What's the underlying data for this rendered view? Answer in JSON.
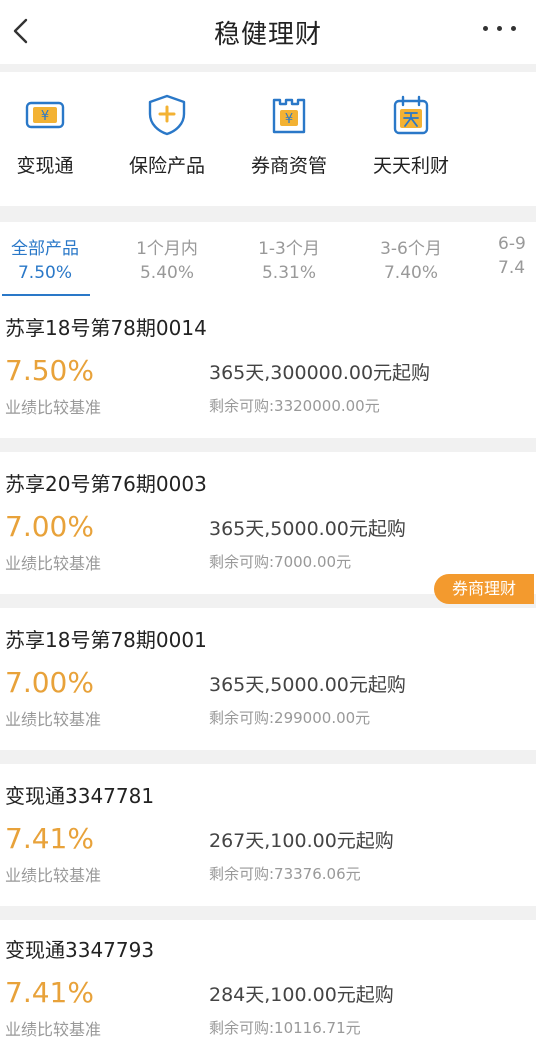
{
  "header": {
    "title": "稳健理财",
    "back_icon": "chevron-left-icon",
    "more_icon": "more-horizontal-icon"
  },
  "accent_color": "#2a78c8",
  "rate_color": "#e8a23a",
  "badge_color": "#f39a2e",
  "quick_links": [
    {
      "label": "变现通",
      "icon": "yen-ticket-icon"
    },
    {
      "label": "保险产品",
      "icon": "shield-plus-icon"
    },
    {
      "label": "券商资管",
      "icon": "yen-tower-icon"
    },
    {
      "label": "天天利财",
      "icon": "calendar-tian-icon"
    }
  ],
  "tabs": [
    {
      "label": "全部产品",
      "rate": "7.50%",
      "active": true
    },
    {
      "label": "1个月内",
      "rate": "5.40%"
    },
    {
      "label": "1-3个月",
      "rate": "5.31%"
    },
    {
      "label": "3-6个月",
      "rate": "7.40%"
    },
    {
      "label": "6-9",
      "rate": "7.4"
    }
  ],
  "products": [
    {
      "name": "苏享18号第78期0014",
      "rate": "7.50%",
      "rate_label": "业绩比较基准",
      "terms": "365天,300000.00元起购",
      "remaining": "剩余可购:3320000.00元"
    },
    {
      "name": "苏享20号第76期0003",
      "rate": "7.00%",
      "rate_label": "业绩比较基准",
      "terms": "365天,5000.00元起购",
      "remaining": "剩余可购:7000.00元",
      "badge": "券商理财"
    },
    {
      "name": "苏享18号第78期0001",
      "rate": "7.00%",
      "rate_label": "业绩比较基准",
      "terms": "365天,5000.00元起购",
      "remaining": "剩余可购:299000.00元"
    },
    {
      "name": "变现通3347781",
      "rate": "7.41%",
      "rate_label": "业绩比较基准",
      "terms": "267天,100.00元起购",
      "remaining": "剩余可购:73376.06元"
    },
    {
      "name": "变现通3347793",
      "rate": "7.41%",
      "rate_label": "业绩比较基准",
      "terms": "284天,100.00元起购",
      "remaining": "剩余可购:10116.71元"
    }
  ]
}
